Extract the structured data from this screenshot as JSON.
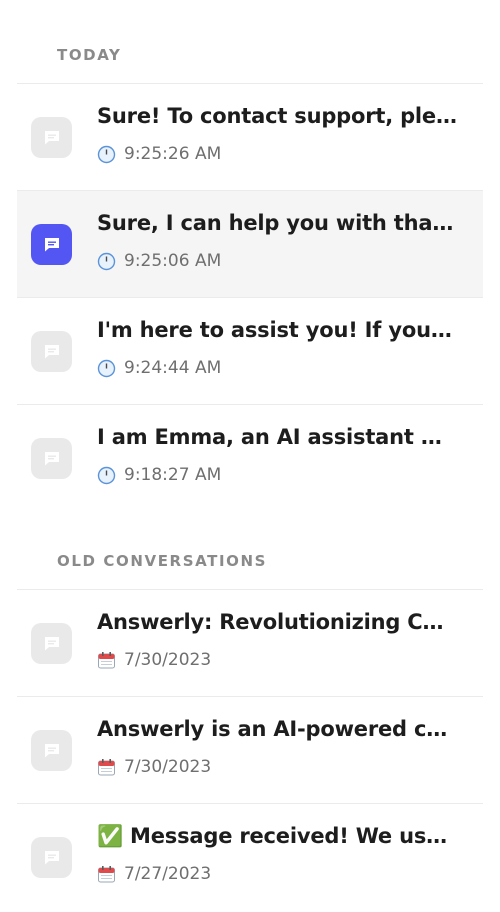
{
  "sections": {
    "today": {
      "label": "TODAY",
      "items": [
        {
          "title": "Sure! To contact support, ple…",
          "time": "9:25:26 AM"
        },
        {
          "title": "Sure, I can help you with that…",
          "time": "9:25:06 AM"
        },
        {
          "title": "I'm here to assist you! If you …",
          "time": "9:24:44 AM"
        },
        {
          "title": "I am Emma, an AI assistant w…",
          "time": "9:18:27 AM"
        }
      ]
    },
    "old": {
      "label": "OLD CONVERSATIONS",
      "items": [
        {
          "title": "Answerly: Revolutionizing C…",
          "date": "7/30/2023"
        },
        {
          "title": "Answerly is an AI-powered c…",
          "date": "7/30/2023"
        },
        {
          "title": "✅ Message received! We usu…",
          "date": "7/27/2023"
        }
      ]
    }
  },
  "colors": {
    "active_icon_bg": "#5356f3",
    "inactive_icon_bg": "#e9e9e9",
    "active_row_bg": "#f5f5f5",
    "section_label": "#8a8a8a",
    "meta_text": "#6f6f6f"
  },
  "icons": {
    "chat": "chat-bubble-icon",
    "time": "clock-icon",
    "date": "calendar-icon"
  },
  "active_item": "today.1"
}
